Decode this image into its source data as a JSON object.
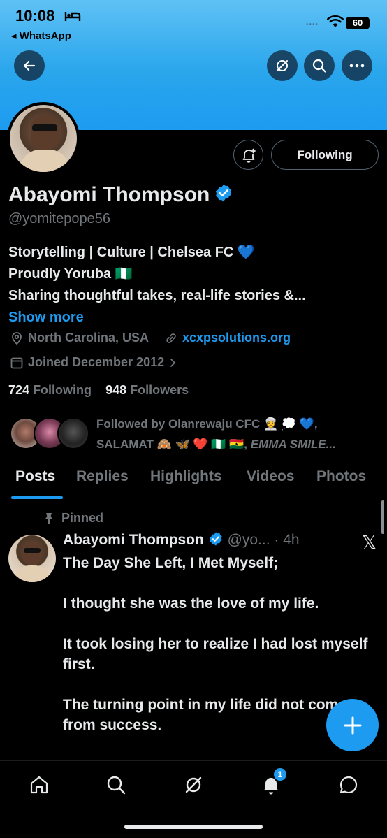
{
  "status_bar": {
    "time": "10:08",
    "back_app": "◂ WhatsApp",
    "signal": "••••",
    "battery": "60"
  },
  "header": {
    "back_icon": "arrow-left-icon",
    "grok_icon": "slash-circle-icon",
    "search_icon": "search-icon",
    "more_icon": "ellipsis-icon"
  },
  "profile": {
    "name": "Abayomi Thompson",
    "handle": "@yomitepope56",
    "following_button": "Following",
    "bio_line1": "Storytelling | Culture | Chelsea FC 💙",
    "bio_line2": "Proudly Yoruba 🇳🇬",
    "bio_line3": "Sharing thoughtful takes, real-life stories &...",
    "show_more": "Show more",
    "location": "North Carolina, USA",
    "website": "xcxpsolutions.org",
    "joined": "Joined December 2012",
    "following_count": "724",
    "following_label": "Following",
    "followers_count": "948",
    "followers_label": "Followers",
    "followed_by_line1": "Followed by Olanrewaju CFC 👳 💭 💙,",
    "followed_by_line2": "SALAMAT 🙈 🦋 ❤️ 🇳🇬 🇬🇭, ",
    "followed_by_emma": "EMMA SMILE..."
  },
  "tabs": [
    "Posts",
    "Replies",
    "Highlights",
    "Videos",
    "Photos"
  ],
  "pinned_post": {
    "pinned_label": "Pinned",
    "author": "Abayomi Thompson",
    "handle": "@yo...",
    "time": "· 4h",
    "x_logo": "𝕏",
    "paragraphs": [
      "The Day She Left, I Met Myself;",
      "I thought she was the love of my life.",
      "It took losing her to realize I had lost myself first.",
      "The turning point in my life did not come from success."
    ]
  },
  "fab": {
    "icon": "plus-icon"
  },
  "bottom_nav": {
    "items": [
      "home-icon",
      "search-icon",
      "grok-icon",
      "notifications-icon",
      "messages-icon"
    ],
    "notification_badge": "1"
  },
  "colors": {
    "accent": "#1d9bf0",
    "muted": "#71767b",
    "text": "#e7e9ea",
    "background": "#000000"
  }
}
